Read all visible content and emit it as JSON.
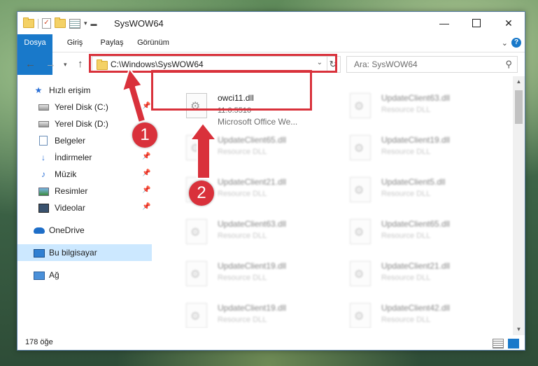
{
  "window": {
    "title": "SysWOW64"
  },
  "window_controls": {
    "minimize": "—",
    "close": "✕"
  },
  "ribbon": {
    "tabs": [
      "Dosya",
      "Giriş",
      "Paylaş",
      "Görünüm"
    ],
    "chevron": "⌄",
    "help": "?"
  },
  "address": {
    "path": "C:\\Windows\\SysWOW64",
    "search_placeholder": "Ara: SysWOW64"
  },
  "nav": {
    "quick_access": "Hızlı erişim",
    "items": [
      {
        "label": "Yerel Disk (C:)",
        "pinned": true
      },
      {
        "label": "Yerel Disk (D:)",
        "pinned": false
      },
      {
        "label": "Belgeler",
        "pinned": true
      },
      {
        "label": "İndirmeler",
        "pinned": true
      },
      {
        "label": "Müzik",
        "pinned": true
      },
      {
        "label": "Resimler",
        "pinned": true
      },
      {
        "label": "Videolar",
        "pinned": true
      }
    ],
    "onedrive": "OneDrive",
    "this_pc": "Bu bilgisayar",
    "network": "Ağ"
  },
  "files": {
    "highlighted": {
      "name": "owci11.dll",
      "version": "11.0.5510",
      "description": "Microsoft Office We..."
    },
    "blurred": [
      {
        "name": "UpdateClient63.dll",
        "description": "Resource DLL"
      },
      {
        "name": "UpdateClient65.dll",
        "description": "Resource DLL"
      },
      {
        "name": "UpdateClient19.dll",
        "description": "Resource DLL"
      },
      {
        "name": "UpdateClient21.dll",
        "description": "Resource DLL"
      },
      {
        "name": "UpdateClient5.dll",
        "description": "Resource DLL"
      },
      {
        "name": "UpdateClient63.dll",
        "description": "Resource DLL"
      },
      {
        "name": "UpdateClient65.dll",
        "description": "Resource DLL"
      },
      {
        "name": "UpdateClient19.dll",
        "description": "Resource DLL"
      },
      {
        "name": "UpdateClient21.dll",
        "description": "Resource DLL"
      },
      {
        "name": "UpdateClient19.dll",
        "description": "Resource DLL"
      },
      {
        "name": "UpdateClient42.dll",
        "description": "Resource DLL"
      }
    ]
  },
  "status": {
    "item_count": "178 öğe"
  },
  "callouts": [
    "1",
    "2"
  ],
  "colors": {
    "accent": "#1979ca",
    "highlight_red": "#d9313b",
    "selected_nav": "#cce8ff"
  }
}
